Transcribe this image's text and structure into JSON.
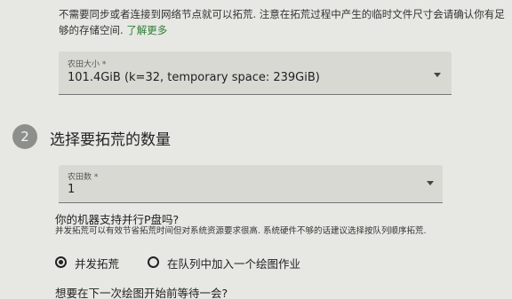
{
  "intro": {
    "text": "不需要同步或者连接到网络节点就可以拓荒. 注意在拓荒过程中产生的临时文件尺寸会请确认你有足够的存储空间.",
    "link": "了解更多"
  },
  "plot_size": {
    "label": "农田大小 *",
    "value": "101.4GiB (k=32, temporary space: 239GiB)"
  },
  "step": {
    "number": "2",
    "title": "选择要拓荒的数量"
  },
  "plot_count": {
    "label": "农田数 *",
    "value": "1"
  },
  "parallel": {
    "question": "你的机器支持并行P盘吗?",
    "hint": "并发拓荒可以有效节省拓荒时间但对系统资源要求很高. 系统硬件不够的话建议选择按队列顺序拓荒.",
    "options": [
      {
        "label": "并发拓荒",
        "selected": true
      },
      {
        "label": "在队列中加入一个绘图作业",
        "selected": false
      }
    ]
  },
  "next_question": "想要在下一次绘图开始前等待一会?"
}
